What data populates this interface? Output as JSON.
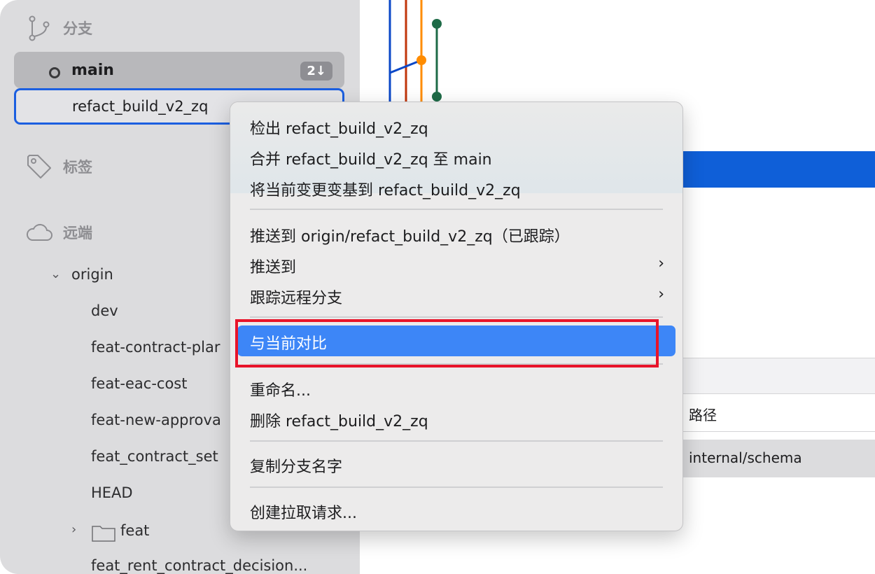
{
  "sidebar": {
    "branches_label": "分支",
    "main_branch": "main",
    "main_badge": "2↓",
    "selected_branch": "refact_build_v2_zq",
    "tags_label": "标签",
    "remote_label": "远端",
    "origin": "origin",
    "remote_items": [
      "dev",
      "feat-contract-plar",
      "feat-eac-cost",
      "feat-new-approva",
      "feat_contract_set",
      "HEAD"
    ],
    "folder": "feat",
    "last_item": "feat_rent_contract_decision..."
  },
  "menu": {
    "checkout": "检出 refact_build_v2_zq",
    "merge": "合并 refact_build_v2_zq 至 main",
    "rebase": "将当前变更变基到 refact_build_v2_zq",
    "push_tracked": "推送到 origin/refact_build_v2_zq（已跟踪）",
    "push_to": "推送到",
    "track_remote": "跟踪远程分支",
    "compare": "与当前对比",
    "rename": "重命名...",
    "delete": "删除 refact_build_v2_zq",
    "copy_name": "复制分支名字",
    "create_pr": "创建拉取请求..."
  },
  "table": {
    "path_header": "路径",
    "row_path": "internal/schema"
  },
  "colors": {
    "accent": "#3d86f7",
    "selection": "#0f5fd8",
    "highlight_box": "#e8142a",
    "graph_green": "#1e6b47",
    "graph_orange": "#ff8c00",
    "graph_red": "#c0350b",
    "graph_blue": "#0a47c7"
  }
}
